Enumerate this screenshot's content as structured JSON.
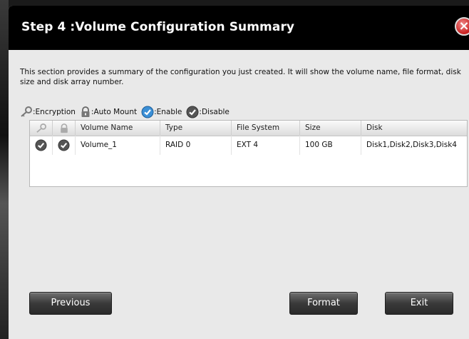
{
  "dialog": {
    "title": "Step 4 :Volume Configuration Summary",
    "close_symbol": "×"
  },
  "description": "This section provides a summary of the configuration you just created. It will show the volume name, file format, disk size and disk array number.",
  "legend": {
    "encryption": ":Encryption",
    "auto_mount": ":Auto Mount",
    "enable": ":Enable",
    "disable": ":Disable"
  },
  "table": {
    "headers": [
      "Volume Name",
      "Type",
      "File System",
      "Size",
      "Disk"
    ],
    "rows": [
      {
        "encryption": "disable",
        "auto_mount": "disable",
        "volume_name": "Volume_1",
        "type": "RAID 0",
        "file_system": "EXT 4",
        "size": "100 GB",
        "disk": "Disk1,Disk2,Disk3,Disk4"
      }
    ]
  },
  "buttons": {
    "previous": "Previous",
    "format": "Format",
    "exit": "Exit"
  },
  "colors": {
    "titlebar": "#000000",
    "dialog_bg": "#e9e9e9",
    "enable_icon": "#3b8fd6",
    "disable_icon": "#555555",
    "close_icon": "#c81e1e"
  }
}
